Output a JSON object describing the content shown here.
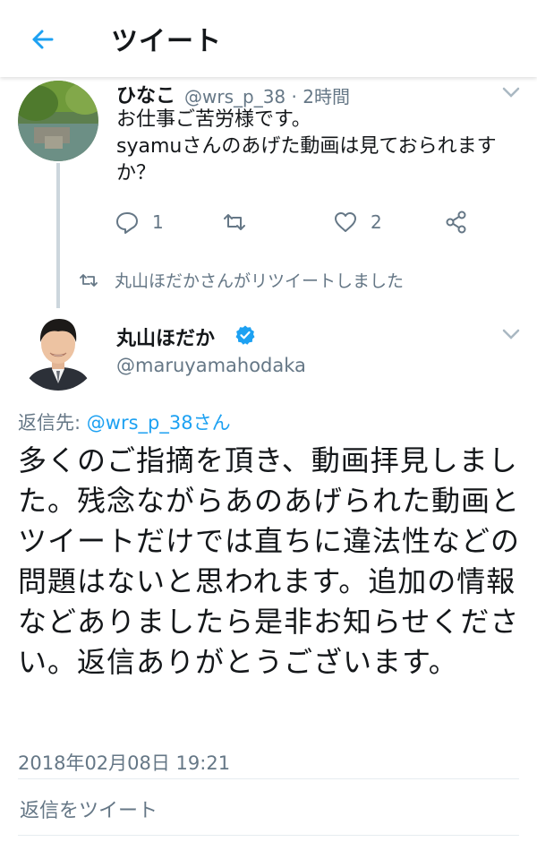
{
  "header": {
    "title": "ツイート"
  },
  "tweet1": {
    "name": "ひなこ",
    "meta": "@wrs_p_38 · 2時間",
    "body": "お仕事ご苦労様です。\nsyamuさんのあげた動画は見ておられますか？",
    "reply_count": "1",
    "like_count": "2"
  },
  "retweet_notice": "丸山ほだかさんがリツイートしました",
  "tweet2": {
    "name": "丸山ほだか",
    "handle": "@maruyamahodaka",
    "reply_prefix": "返信先: ",
    "reply_target": "@wrs_p_38さん",
    "body": "多くのご指摘を頂き、動画拝見しました。残念ながらあのあげられた動画とツイートだけでは直ちに違法性などの問題はないと思われます。追加の情報などありましたら是非お知らせください。返信ありがとうございます。",
    "timestamp": "2018年02月08日 19:21"
  },
  "reply_button": "返信をツイート",
  "colors": {
    "accent": "#1da1f2",
    "muted": "#657786",
    "divider": "#e6ecf0"
  }
}
